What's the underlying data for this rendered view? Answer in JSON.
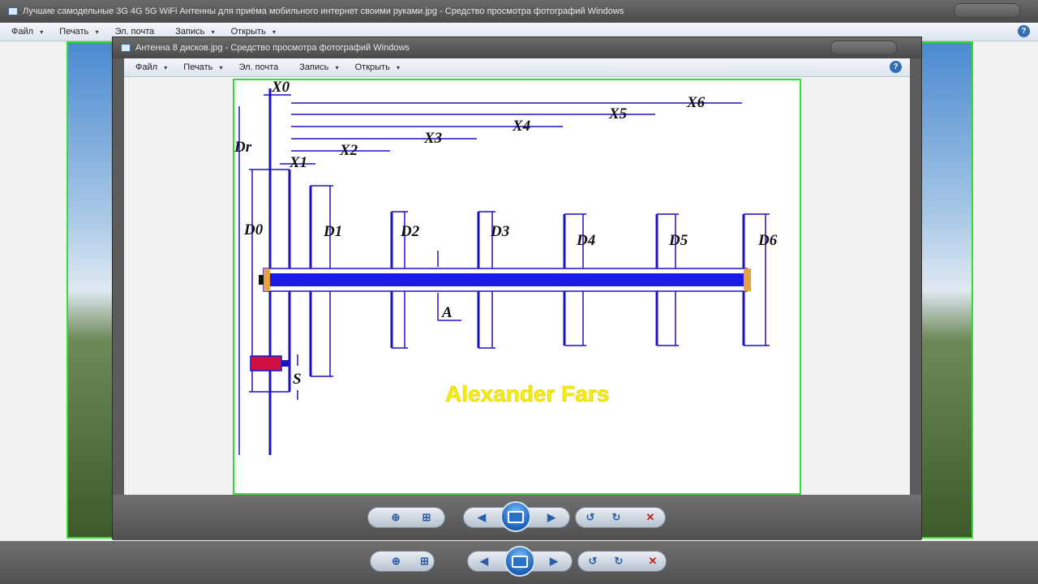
{
  "back_window": {
    "title": "Лучшие самодельные 3G 4G 5G WiFi Антенны для приёма мобильного интернет своими руками.jpg - Средство просмотра фотографий Windows",
    "menu": [
      "Файл",
      "Печать",
      "Эл. почта",
      "Запись",
      "Открыть"
    ],
    "help": "?"
  },
  "front_window": {
    "title": "Антенна 8 дисков.jpg - Средство просмотра фотографий Windows",
    "menu": [
      "Файл",
      "Печать",
      "Эл. почта",
      "Запись",
      "Открыть"
    ],
    "help": "?"
  },
  "diagram": {
    "labels": {
      "x0": "X0",
      "x1": "X1",
      "x2": "X2",
      "x3": "X3",
      "x4": "X4",
      "x5": "X5",
      "x6": "X6",
      "dr": "Dr",
      "d0": "D0",
      "d1": "D1",
      "d2": "D2",
      "d3": "D3",
      "d4": "D4",
      "d5": "D5",
      "d6": "D6",
      "a": "A",
      "s": "S"
    },
    "watermark": "Alexander Fars",
    "colors": {
      "lines": "#1c10c8",
      "boom": "#1a1ae0",
      "connector": "#d01040",
      "end_cap": "#e8a040",
      "watermark": "#f4f000"
    }
  },
  "toolbar": {
    "icons": [
      "zoom-icon",
      "fit-icon",
      "prev-icon",
      "slideshow-icon",
      "next-icon",
      "rotate-left-icon",
      "rotate-right-icon",
      "delete-icon"
    ]
  }
}
